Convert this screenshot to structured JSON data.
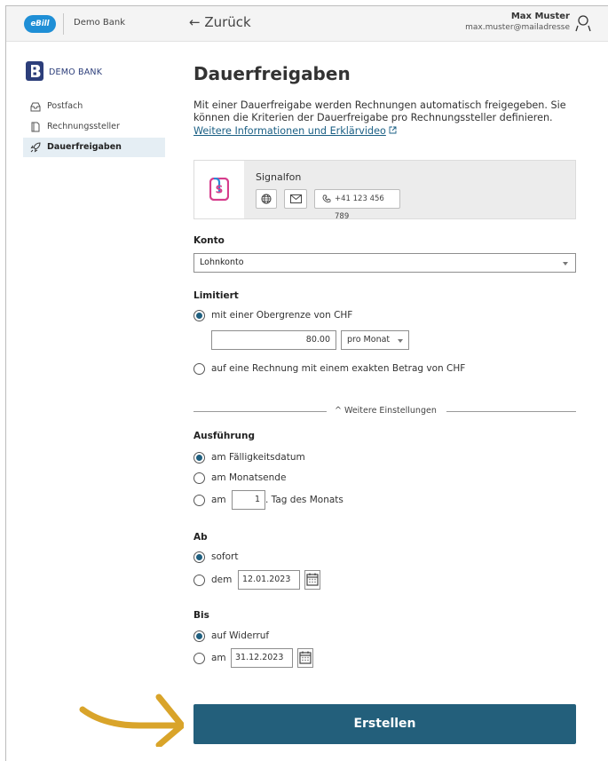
{
  "topbar": {
    "logo": "eBill",
    "bank_name": "Demo Bank",
    "back_label": "← Zurück",
    "user_name": "Max Muster",
    "user_email": "max.muster@mailadresse"
  },
  "sidebar": {
    "brand": "DEMO BANK",
    "items": [
      {
        "label": "Postfach",
        "icon": "inbox-icon"
      },
      {
        "label": "Rechnungssteller",
        "icon": "document-icon"
      },
      {
        "label": "Dauerfreigaben",
        "icon": "rocket-icon",
        "active": true
      }
    ]
  },
  "main": {
    "title": "Dauerfreigaben",
    "intro": "Mit einer Dauerfreigabe werden Rechnungen automatisch freigegeben. Sie können die Kriterien der Dauerfreigabe pro Rechnungssteller definieren.",
    "info_link": "Weitere Informationen und Erklärvideo",
    "biller": {
      "name": "Signalfon",
      "phone": "+41 123 456 789"
    },
    "konto": {
      "label": "Konto",
      "value": "Lohnkonto"
    },
    "limitiert": {
      "label": "Limitiert",
      "option_max": "mit einer Obergrenze von CHF",
      "amount": "80.00",
      "period": "pro Monat",
      "option_exact": "auf eine Rechnung mit einem exakten Betrag von CHF"
    },
    "more_settings": "Weitere Einstellungen",
    "ausfuehrung": {
      "label": "Ausführung",
      "option_due": "am Fälligkeitsdatum",
      "option_month_end": "am Monatsende",
      "option_day_prefix": "am",
      "day_value": "1",
      "option_day_suffix": ". Tag des Monats"
    },
    "ab": {
      "label": "Ab",
      "option_now": "sofort",
      "option_date": "dem",
      "date_value": "12.01.2023"
    },
    "bis": {
      "label": "Bis",
      "option_revoke": "auf Widerruf",
      "option_date": "am",
      "date_value": "31.12.2023"
    },
    "submit": "Erstellen"
  },
  "colors": {
    "primary": "#235f7b",
    "ebill_blue": "#1f8fd6",
    "link": "#1a5f84",
    "arrow": "#d9a42a"
  }
}
